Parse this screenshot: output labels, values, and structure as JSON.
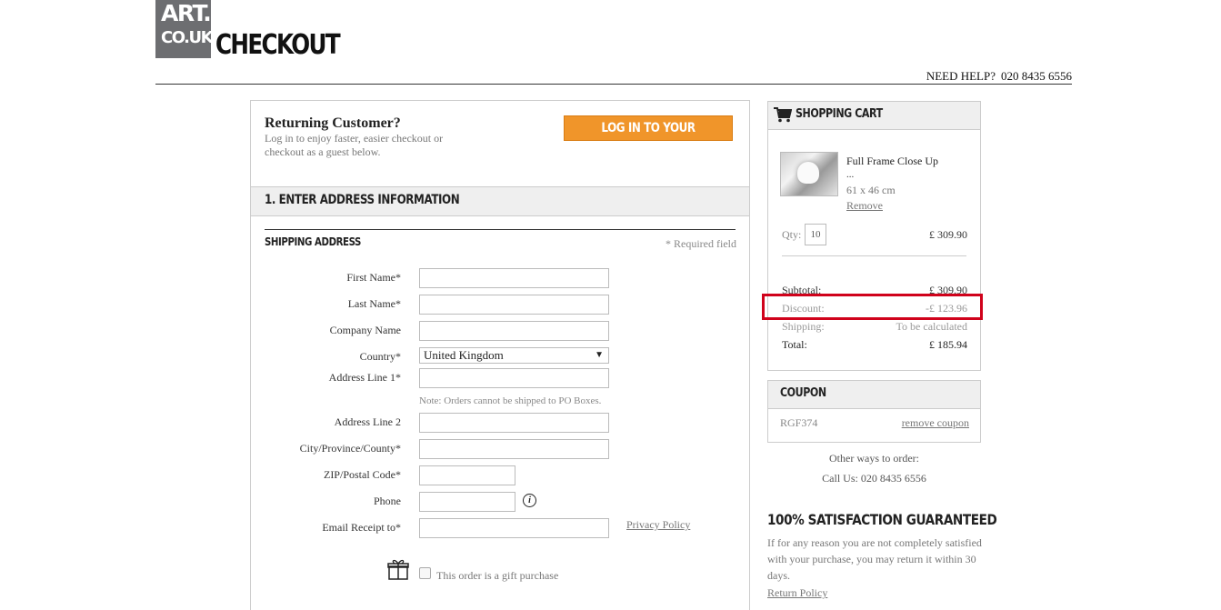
{
  "header": {
    "logo_line1": "ART.",
    "logo_line2": "CO.UK",
    "title": "CHECKOUT",
    "help_label": "NEED HELP?",
    "help_phone": "020 8435 6556"
  },
  "returning": {
    "title": "Returning Customer?",
    "subtitle": "Log in to enjoy faster, easier checkout or checkout as a guest below.",
    "login_button": "LOG IN TO YOUR ACCOUNT"
  },
  "address_section": {
    "title": "1. ENTER ADDRESS INFORMATION",
    "shipping_title": "SHIPPING ADDRESS",
    "required_note": "* Required field",
    "fields": {
      "first_name": "First Name*",
      "last_name": "Last Name*",
      "company": "Company Name",
      "country": "Country*",
      "country_value": "United Kingdom",
      "address1": "Address Line 1*",
      "address1_note": "Note: Orders cannot be shipped to PO Boxes.",
      "address2": "Address Line 2",
      "city": "City/Province/County*",
      "zip": "ZIP/Postal Code*",
      "phone": "Phone",
      "email": "Email Receipt to*"
    },
    "privacy_link": "Privacy Policy",
    "gift_label": "This order is a gift purchase"
  },
  "cart": {
    "title": "SHOPPING CART",
    "product_name": "Full Frame Close Up",
    "product_more": "...",
    "product_size": "61 x 46 cm",
    "remove_label": "Remove",
    "qty_label": "Qty:",
    "qty_value": "10",
    "item_price": "£ 309.90",
    "subtotal_label": "Subtotal:",
    "subtotal_value": "£ 309.90",
    "discount_label": "Discount:",
    "discount_value": "-£ 123.96",
    "shipping_label": "Shipping:",
    "shipping_value": "To be calculated",
    "total_label": "Total:",
    "total_value": "£ 185.94"
  },
  "coupon": {
    "title": "COUPON",
    "code": "RGF374",
    "remove_label": "remove coupon"
  },
  "other_ways": "Other ways to order:",
  "call_us": "Call Us: 020 8435 6556",
  "guarantee": {
    "title": "100% SATISFACTION GUARANTEED",
    "text": "If for any reason you are not completely satisfied with your purchase, you may return it within 30 days.",
    "return_link": "Return Policy"
  }
}
